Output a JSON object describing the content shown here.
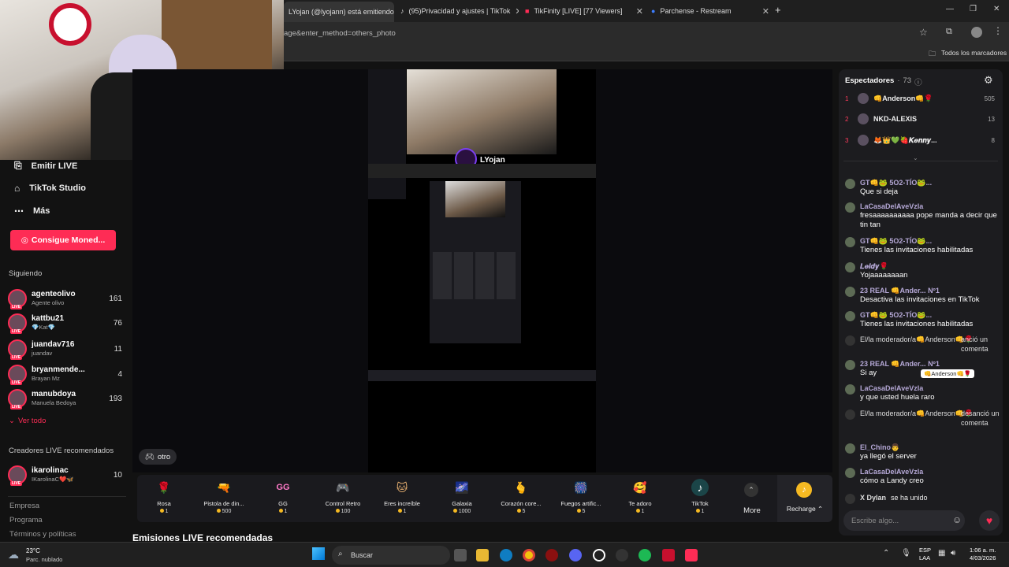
{
  "browser": {
    "tabs": [
      {
        "label": "LYojan (@lyojann) está emitiendo",
        "active": true
      },
      {
        "label": "(95)Privacidad y ajustes | TikTok"
      },
      {
        "label": "TikFinity [LIVE] [77 Viewers]"
      },
      {
        "label": "Parchense - Restream"
      }
    ],
    "url": "age&enter_method=others_photo",
    "bookmarks_label": "Todos los marcadores"
  },
  "sidebar": {
    "menu": [
      {
        "label": "Emitir LIVE",
        "icon": "live-camera-icon"
      },
      {
        "label": "TikTok Studio",
        "icon": "studio-house-icon"
      },
      {
        "label": "Más",
        "icon": "more-dots-icon"
      }
    ],
    "coins_button": "Consigue Moned...",
    "following_header": "Siguiendo",
    "following": [
      {
        "name": "agenteolivo",
        "sub": "Agente olivo",
        "count": "161"
      },
      {
        "name": "kattbu21",
        "sub": "💎Kat💎",
        "count": "76"
      },
      {
        "name": "juandav716",
        "sub": "juandav",
        "count": "11"
      },
      {
        "name": "bryanmende...",
        "sub": "Brayan Mz",
        "count": "4"
      },
      {
        "name": "manubdoya",
        "sub": "Manuela Bedoya",
        "count": "193"
      }
    ],
    "see_all": "Ver todo",
    "recommended_header": "Creadores LIVE recomendados",
    "recommended": [
      {
        "name": "ikarolinac",
        "sub": "IKarolinaC❤️🦋",
        "count": "10"
      }
    ],
    "footer_links": [
      "Empresa",
      "Programa",
      "Términos y políticas"
    ]
  },
  "stream": {
    "streamer_name": "LYojan",
    "category_chip": "otro",
    "recommended_title": "Emisiones LIVE recomendadas"
  },
  "gifts": [
    {
      "name": "Rosa",
      "price": "1",
      "emoji": "🌹"
    },
    {
      "name": "Pistola de din...",
      "price": "500",
      "emoji": "🔫"
    },
    {
      "name": "GG",
      "price": "1",
      "emoji": "GG"
    },
    {
      "name": "Control Retro",
      "price": "100",
      "emoji": "🎮"
    },
    {
      "name": "Eres increíble",
      "price": "1",
      "emoji": "🐱"
    },
    {
      "name": "Galaxia",
      "price": "1000",
      "emoji": "🌌"
    },
    {
      "name": "Corazón core...",
      "price": "5",
      "emoji": "🫰"
    },
    {
      "name": "Fuegos artific...",
      "price": "5",
      "emoji": "🎆"
    },
    {
      "name": "Te adoro",
      "price": "1",
      "emoji": "🥰"
    },
    {
      "name": "TikTok",
      "price": "1",
      "emoji": "♪"
    }
  ],
  "gift_more": "More",
  "recharge": "Recharge",
  "viewers_panel": {
    "title": "Espectadores",
    "count": "73",
    "top": [
      {
        "rank": "1",
        "name": "👊Anderson👊🌹",
        "count": "505"
      },
      {
        "rank": "2",
        "name": "NKD-ALEXIS",
        "count": "13"
      },
      {
        "rank": "3",
        "name": "🦊👑💚🍓𝑲𝒆𝒏𝒏𝒚...",
        "count": "8"
      }
    ]
  },
  "chat": [
    {
      "user": "GT👊🐸 5O2-TÍO🐸...",
      "text": "Que si deja"
    },
    {
      "user": "LaCasaDelAveVzla",
      "text": "fresaaaaaaaaaa pope manda a decir que tin tan"
    },
    {
      "user": "GT👊🐸 5O2-TÍO🐸...",
      "text": "Tienes las invitaciones habilitadas"
    },
    {
      "user": "𝑳𝒆𝒊𝒅𝒚🌹",
      "text": "Yojaaaaaaaan"
    },
    {
      "user": "23 REAL 👊Ander... Nº1",
      "text": "Desactiva las invitaciones en TikTok"
    },
    {
      "user": "GT👊🐸 5O2-TÍO🐸...",
      "text": "Tienes las invitaciones habilitadas"
    },
    {
      "user": "El/la moderador/a👊Anderson👊🌹",
      "text": "anció un comenta",
      "system": true
    },
    {
      "user": "23 REAL 👊Ander... Nº1",
      "text": "Si ay"
    },
    {
      "user": "LaCasaDelAveVzla",
      "text": "y que usted huela raro"
    },
    {
      "user": "El/la moderador/a👊Anderson👊🌹",
      "text": "desanció un comenta",
      "system": true
    },
    {
      "user": "El_Chino👨",
      "text": "ya llegó el server"
    },
    {
      "user": "LaCasaDelAveVzla",
      "text": "cómo a Landy creo"
    },
    {
      "user": "X Dylan",
      "text": "se ha unido",
      "system": true
    }
  ],
  "tooltip": "👊Anderson👊🌹",
  "chat_input_placeholder": "Escribe algo...",
  "taskbar": {
    "weather_temp": "23°C",
    "weather_desc": "Parc. nublado",
    "search_placeholder": "Buscar",
    "lang": "ESP",
    "lang_sub": "LAA",
    "time": "1:06 a. m.",
    "date": "4/03/2026"
  }
}
